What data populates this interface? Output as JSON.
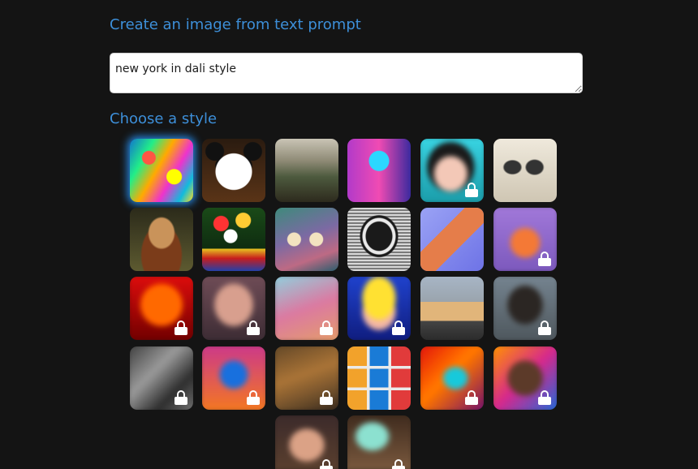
{
  "headings": {
    "create": "Create an image from text prompt",
    "style": "Choose a style"
  },
  "prompt": {
    "value": "new york in dali style"
  },
  "colors": {
    "background": "#141414",
    "heading": "#3d8fd9",
    "selected_glow": "#2896ff"
  },
  "styles": [
    {
      "id": "abstract",
      "locked": false,
      "selected": true
    },
    {
      "id": "panda",
      "locked": false,
      "selected": false
    },
    {
      "id": "landscape-painting",
      "locked": false,
      "selected": false
    },
    {
      "id": "robot",
      "locked": false,
      "selected": false
    },
    {
      "id": "anime-portrait",
      "locked": true,
      "selected": false
    },
    {
      "id": "engraving",
      "locked": false,
      "selected": false
    },
    {
      "id": "renaissance",
      "locked": false,
      "selected": false
    },
    {
      "id": "flowers",
      "locked": false,
      "selected": false
    },
    {
      "id": "ballet",
      "locked": false,
      "selected": false
    },
    {
      "id": "pencil-sketch",
      "locked": false,
      "selected": false
    },
    {
      "id": "isometric",
      "locked": false,
      "selected": false
    },
    {
      "id": "fox",
      "locked": true,
      "selected": false
    },
    {
      "id": "thermal",
      "locked": true,
      "selected": false
    },
    {
      "id": "portrait",
      "locked": true,
      "selected": false
    },
    {
      "id": "pastel",
      "locked": true,
      "selected": false
    },
    {
      "id": "pop-art",
      "locked": true,
      "selected": false
    },
    {
      "id": "architecture",
      "locked": false,
      "selected": false
    },
    {
      "id": "sculpture",
      "locked": true,
      "selected": false
    },
    {
      "id": "gray-texture",
      "locked": true,
      "selected": false
    },
    {
      "id": "neon-figure",
      "locked": true,
      "selected": false
    },
    {
      "id": "oil-painting",
      "locked": true,
      "selected": false
    },
    {
      "id": "icon-grid",
      "locked": false,
      "selected": false
    },
    {
      "id": "psychedelic",
      "locked": true,
      "selected": false
    },
    {
      "id": "colorful-face",
      "locked": true,
      "selected": false
    },
    {
      "id": "fantasy-portrait",
      "locked": true,
      "selected": false
    },
    {
      "id": "nature",
      "locked": true,
      "selected": false
    }
  ]
}
